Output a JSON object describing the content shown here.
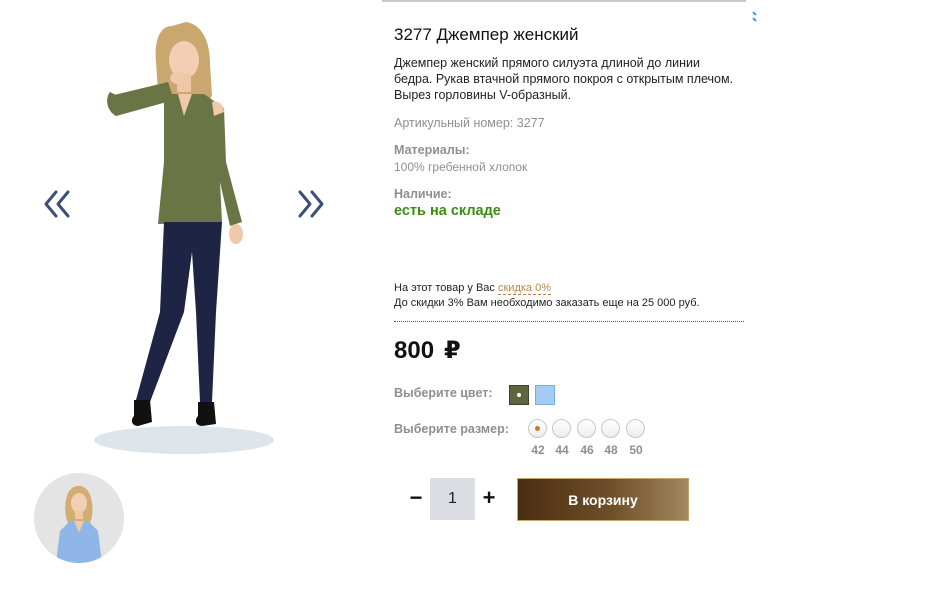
{
  "product": {
    "title": "3277 Джемпер женский",
    "description": "Джемпер женский прямого силуэта длиной до линии бедра. Рукав втачной прямого покроя с открытым плечом. Вырез горловины V-образный.",
    "sku": "Артикульный номер: 3277",
    "materials_label": "Материалы:",
    "materials_value": "100% гребенной хлопок",
    "availability_label": "Наличие:",
    "availability_value": "есть на складе"
  },
  "discount": {
    "line1_prefix": "На этот товар у Вас ",
    "line1_link": "скидка 0%",
    "line2": "До скидки 3% Вам необходимо заказать еще на 25 000 руб."
  },
  "price": {
    "value": "800",
    "currency": "₽"
  },
  "color": {
    "label": "Выберите цвет:",
    "options": [
      "#5f6441",
      "#a6cbf0"
    ],
    "selected_index": 0
  },
  "size": {
    "label": "Выберите размер:",
    "options": [
      "42",
      "44",
      "46",
      "48",
      "50"
    ],
    "selected": "42"
  },
  "quantity": {
    "minus": "−",
    "value": "1",
    "plus": "+"
  },
  "cart_button": "В корзину",
  "gallery": {
    "prev_icon": "chevron-double-left-icon",
    "next_icon": "chevron-double-right-icon"
  },
  "colors": {
    "accent": "#3a8e12",
    "link": "#b58a4c",
    "button_dark": "#4a2e12",
    "arrow": "#3a4f78"
  }
}
